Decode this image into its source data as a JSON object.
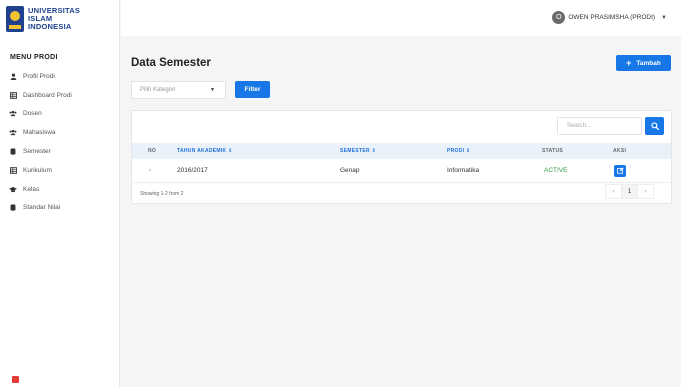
{
  "brand": {
    "line1": "UNIVERSITAS",
    "line2": "ISLAM",
    "line3": "INDONESIA"
  },
  "sidebar": {
    "title": "MENU PRODI",
    "items": [
      {
        "label": "Profil Prodi",
        "icon": "user-icon"
      },
      {
        "label": "Dashboard Prodi",
        "icon": "table-icon"
      },
      {
        "label": "Dosen",
        "icon": "users-icon"
      },
      {
        "label": "Mahasiswa",
        "icon": "users-icon"
      },
      {
        "label": "Semester",
        "icon": "database-icon"
      },
      {
        "label": "Kurikulum",
        "icon": "table-icon"
      },
      {
        "label": "Kelas",
        "icon": "graduation-cap-icon"
      },
      {
        "label": "Standar Nilai",
        "icon": "database-icon"
      }
    ]
  },
  "header": {
    "user_initial": "O",
    "user_name": "OWEN PRASIMSHA (PRODI)"
  },
  "main": {
    "title": "Data Semester",
    "add_label": "Tambah",
    "kategori_placeholder": "Pilih Kategori",
    "filter_label": "Filter",
    "search_placeholder": "Search...",
    "columns": {
      "no": "NO",
      "tahun": "TAHUN AKADEMIK ⇕",
      "semester": "SEMESTER ⇕",
      "prodi": "PRODI ⇕",
      "status": "STATUS",
      "aksi": "AKSI"
    },
    "rows": [
      {
        "no": "‹",
        "tahun": "2016/2017",
        "semester": "Genap",
        "prodi": "Informatika",
        "status": "ACTIVE"
      }
    ],
    "showing": "Showing 1-2 from 2",
    "pager": {
      "prev": "‹",
      "page": "1",
      "next": "›"
    }
  },
  "colors": {
    "primary": "#1877e6",
    "active": "#2e9b3e",
    "brand": "#1f3f8f"
  }
}
